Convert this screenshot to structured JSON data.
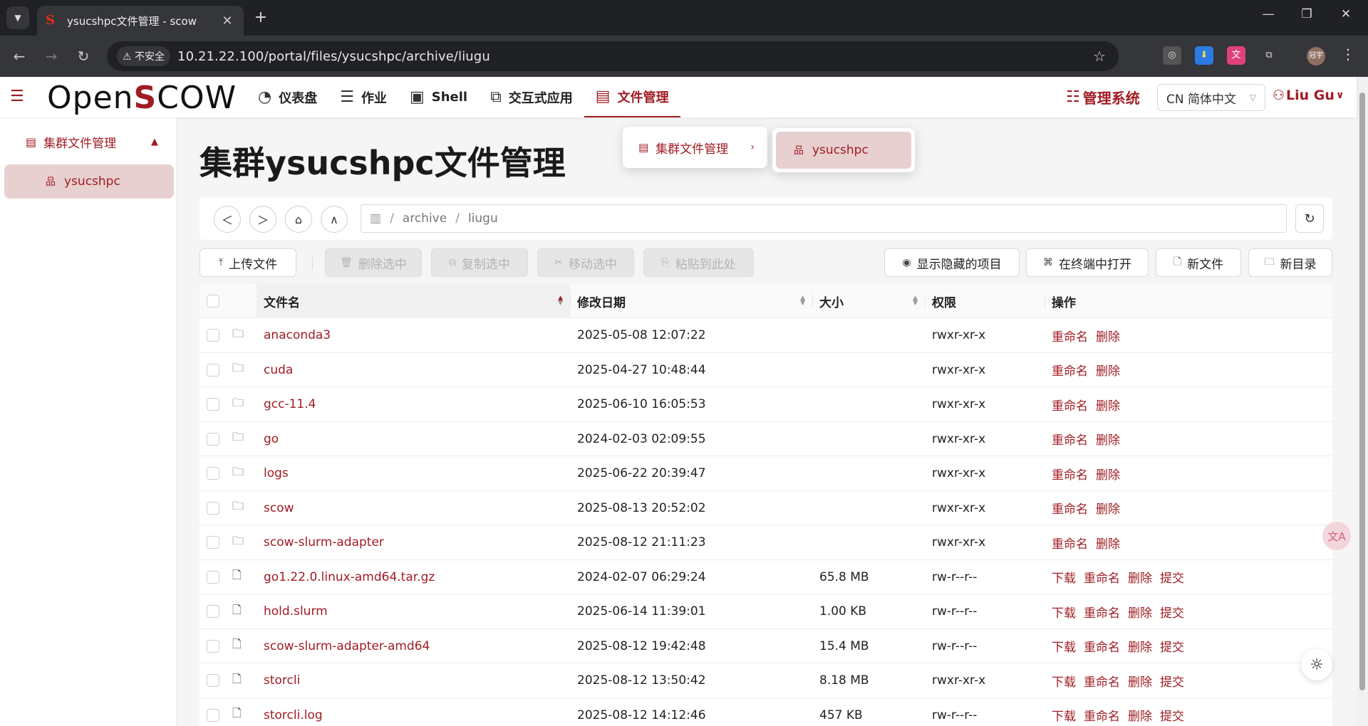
{
  "browser": {
    "tab_title": "ysucshpc文件管理 - scow",
    "favicon": "S",
    "insecure_label": "不安全",
    "url": "10.21.22.100/portal/files/ysucshpc/archive/liugu",
    "profile_label": "冠宇"
  },
  "header": {
    "logo_prefix": "Open",
    "logo_s": "S",
    "logo_suffix": "COW",
    "nav": [
      {
        "label": "仪表盘",
        "icon": "dashboard-icon"
      },
      {
        "label": "作业",
        "icon": "job-icon"
      },
      {
        "label": "Shell",
        "icon": "terminal-icon"
      },
      {
        "label": "交互式应用",
        "icon": "apps-icon"
      },
      {
        "label": "文件管理",
        "icon": "file-icon",
        "active": true
      }
    ],
    "admin_label": "管理系统",
    "language": "CN 简体中文",
    "user": "Liu Gu"
  },
  "sidebar": {
    "group_label": "集群文件管理",
    "items": [
      {
        "label": "ysucshpc"
      }
    ]
  },
  "dropdown": {
    "group_label": "集群文件管理",
    "item_label": "ysucshpc"
  },
  "page": {
    "title": "集群ysucshpc文件管理",
    "path": [
      "archive",
      "liugu"
    ]
  },
  "toolbar": {
    "upload": "上传文件",
    "delete_selected": "删除选中",
    "copy_selected": "复制选中",
    "move_selected": "移动选中",
    "paste_here": "粘贴到此处",
    "show_hidden": "显示隐藏的项目",
    "open_terminal": "在终端中打开",
    "new_file": "新文件",
    "new_dir": "新目录"
  },
  "table": {
    "columns": {
      "name": "文件名",
      "mtime": "修改日期",
      "size": "大小",
      "perm": "权限",
      "actions": "操作"
    },
    "action_labels": {
      "download": "下载",
      "rename": "重命名",
      "delete": "删除",
      "submit": "提交"
    },
    "rows": [
      {
        "type": "dir",
        "name": "anaconda3",
        "mtime": "2025-05-08 12:07:22",
        "size": "",
        "perm": "rwxr-xr-x"
      },
      {
        "type": "dir",
        "name": "cuda",
        "mtime": "2025-04-27 10:48:44",
        "size": "",
        "perm": "rwxr-xr-x"
      },
      {
        "type": "dir",
        "name": "gcc-11.4",
        "mtime": "2025-06-10 16:05:53",
        "size": "",
        "perm": "rwxr-xr-x"
      },
      {
        "type": "dir",
        "name": "go",
        "mtime": "2024-02-03 02:09:55",
        "size": "",
        "perm": "rwxr-xr-x"
      },
      {
        "type": "dir",
        "name": "logs",
        "mtime": "2025-06-22 20:39:47",
        "size": "",
        "perm": "rwxr-xr-x"
      },
      {
        "type": "dir",
        "name": "scow",
        "mtime": "2025-08-13 20:52:02",
        "size": "",
        "perm": "rwxr-xr-x"
      },
      {
        "type": "dir",
        "name": "scow-slurm-adapter",
        "mtime": "2025-08-12 21:11:23",
        "size": "",
        "perm": "rwxr-xr-x"
      },
      {
        "type": "file",
        "name": "go1.22.0.linux-amd64.tar.gz",
        "mtime": "2024-02-07 06:29:24",
        "size": "65.8 MB",
        "perm": "rw-r--r--"
      },
      {
        "type": "file",
        "name": "hold.slurm",
        "mtime": "2025-06-14 11:39:01",
        "size": "1.00 KB",
        "perm": "rw-r--r--"
      },
      {
        "type": "file",
        "name": "scow-slurm-adapter-amd64",
        "mtime": "2025-08-12 19:42:48",
        "size": "15.4 MB",
        "perm": "rw-r--r--"
      },
      {
        "type": "file",
        "name": "storcli",
        "mtime": "2025-08-12 13:50:42",
        "size": "8.18 MB",
        "perm": "rwxr-xr-x"
      },
      {
        "type": "file",
        "name": "storcli.log",
        "mtime": "2025-08-12 14:12:46",
        "size": "457 KB",
        "perm": "rw-r--r--"
      }
    ]
  },
  "colors": {
    "accent": "#a01c23",
    "selected_bg": "#e8d0d0"
  }
}
